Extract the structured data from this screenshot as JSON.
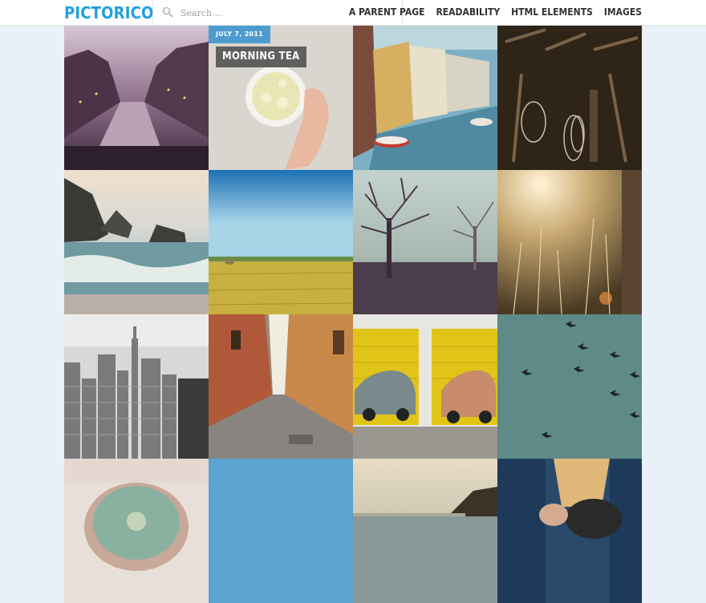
{
  "site": {
    "title": "PICTORICO"
  },
  "search": {
    "placeholder": "Search ...",
    "value": "",
    "icon": "search-icon"
  },
  "nav": {
    "items": [
      {
        "label": "A PARENT PAGE"
      },
      {
        "label": "READABILITY"
      },
      {
        "label": "HTML ELEMENTS"
      },
      {
        "label": "IMAGES"
      }
    ]
  },
  "featured_post": {
    "date": "JULY 7, 2011",
    "title": "MORNING TEA"
  },
  "colors": {
    "accent": "#1fa0e0",
    "background": "#e8f1f8",
    "date_badge": "#4e9ccf",
    "blue_tile": "#5ba3d0"
  }
}
